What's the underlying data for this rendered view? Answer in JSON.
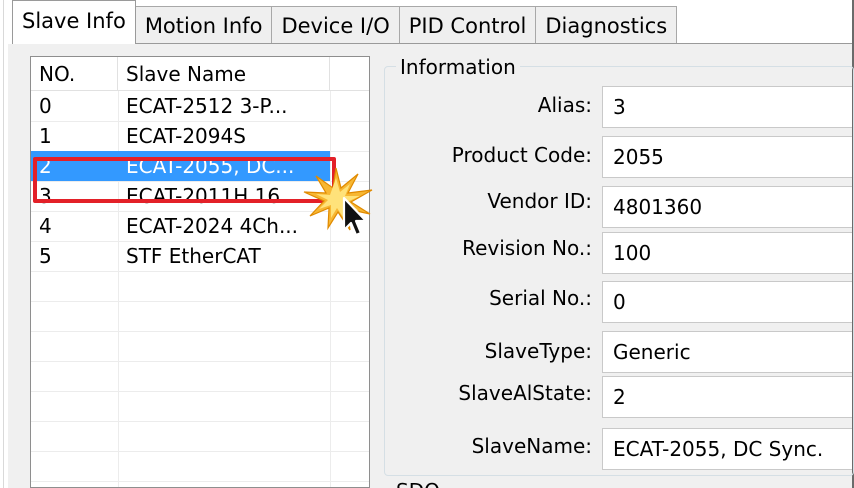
{
  "tabs": [
    {
      "label": "Slave Info",
      "active": true
    },
    {
      "label": "Motion Info",
      "active": false
    },
    {
      "label": "Device I/O",
      "active": false
    },
    {
      "label": "PID Control",
      "active": false
    },
    {
      "label": "Diagnostics",
      "active": false
    }
  ],
  "slave_list": {
    "columns": [
      "NO.",
      "Slave Name"
    ],
    "rows": [
      {
        "no": "0",
        "name": "ECAT-2512 3-P..."
      },
      {
        "no": "1",
        "name": "ECAT-2094S"
      },
      {
        "no": "2",
        "name": "ECAT-2055, DC...",
        "selected": true
      },
      {
        "no": "3",
        "name": "ECAT-2011H 16..."
      },
      {
        "no": "4",
        "name": "ECAT-2024 4Ch..."
      },
      {
        "no": "5",
        "name": "STF EtherCAT"
      }
    ]
  },
  "information": {
    "title": "Information",
    "fields": [
      {
        "label": "Alias:",
        "value": "3"
      },
      {
        "label": "Product Code:",
        "value": "2055"
      },
      {
        "label": "Vendor ID:",
        "value": "4801360"
      },
      {
        "label": "Revision No.:",
        "value": "100"
      },
      {
        "label": "Serial No.:",
        "value": "0"
      },
      {
        "label": "SlaveType:",
        "value": "Generic"
      },
      {
        "label": "SlaveAlState:",
        "value": "2"
      },
      {
        "label": "SlaveName:",
        "value": "ECAT-2055, DC Sync."
      }
    ]
  },
  "next_group_title": "SDO",
  "colors": {
    "selection": "#3399ff",
    "highlight_border": "#e32028",
    "panel": "#f0f0f0"
  },
  "icons": [
    "cursor-arrow-icon",
    "click-burst-icon"
  ]
}
